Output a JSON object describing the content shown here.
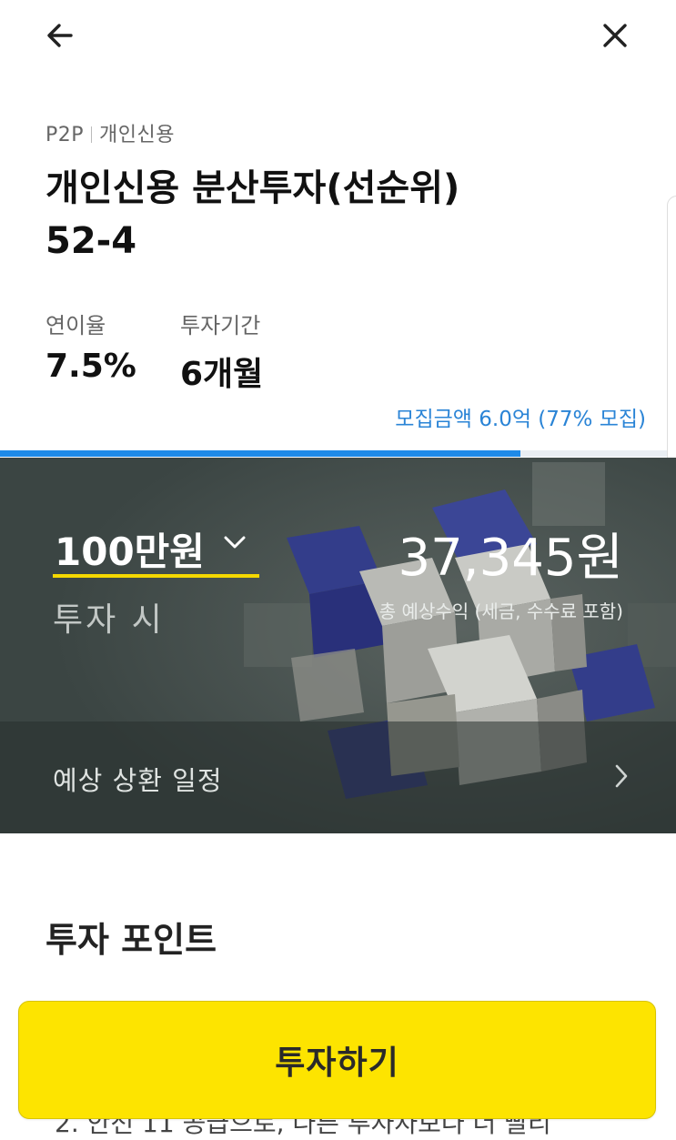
{
  "header": {
    "back_icon": "arrow-left-icon",
    "close_icon": "close-icon"
  },
  "product": {
    "category_primary": "P2P",
    "category_secondary": "개인신용",
    "title_line1": "개인신용 분산투자(선순위)",
    "title_line2": "52-4"
  },
  "stats": {
    "rate_label": "연이율",
    "rate_value": "7.5%",
    "period_label": "투자기간",
    "period_value": "6개월"
  },
  "funding": {
    "text": "모집금액 6.0억 (77% 모집)",
    "progress_fraction": 0.77,
    "accent_color": "#1e8ae8"
  },
  "calculator": {
    "selected_amount": "100만원",
    "amount_caption": "투자 시",
    "expected_profit": "37,345원",
    "profit_caption": "총 예상수익 (세금, 수수료 포함)",
    "underline_color": "#f5d800",
    "dropdown_icon": "chevron-down-icon"
  },
  "schedule": {
    "label": "예상 상환 일정",
    "icon": "chevron-right-icon"
  },
  "points": {
    "heading": "투자 포인트",
    "item2_fragment": "2.  안전 11 공급으로, 다른 투자자보다 더 빨리"
  },
  "cta": {
    "label": "투자하기",
    "color": "#fde400"
  }
}
